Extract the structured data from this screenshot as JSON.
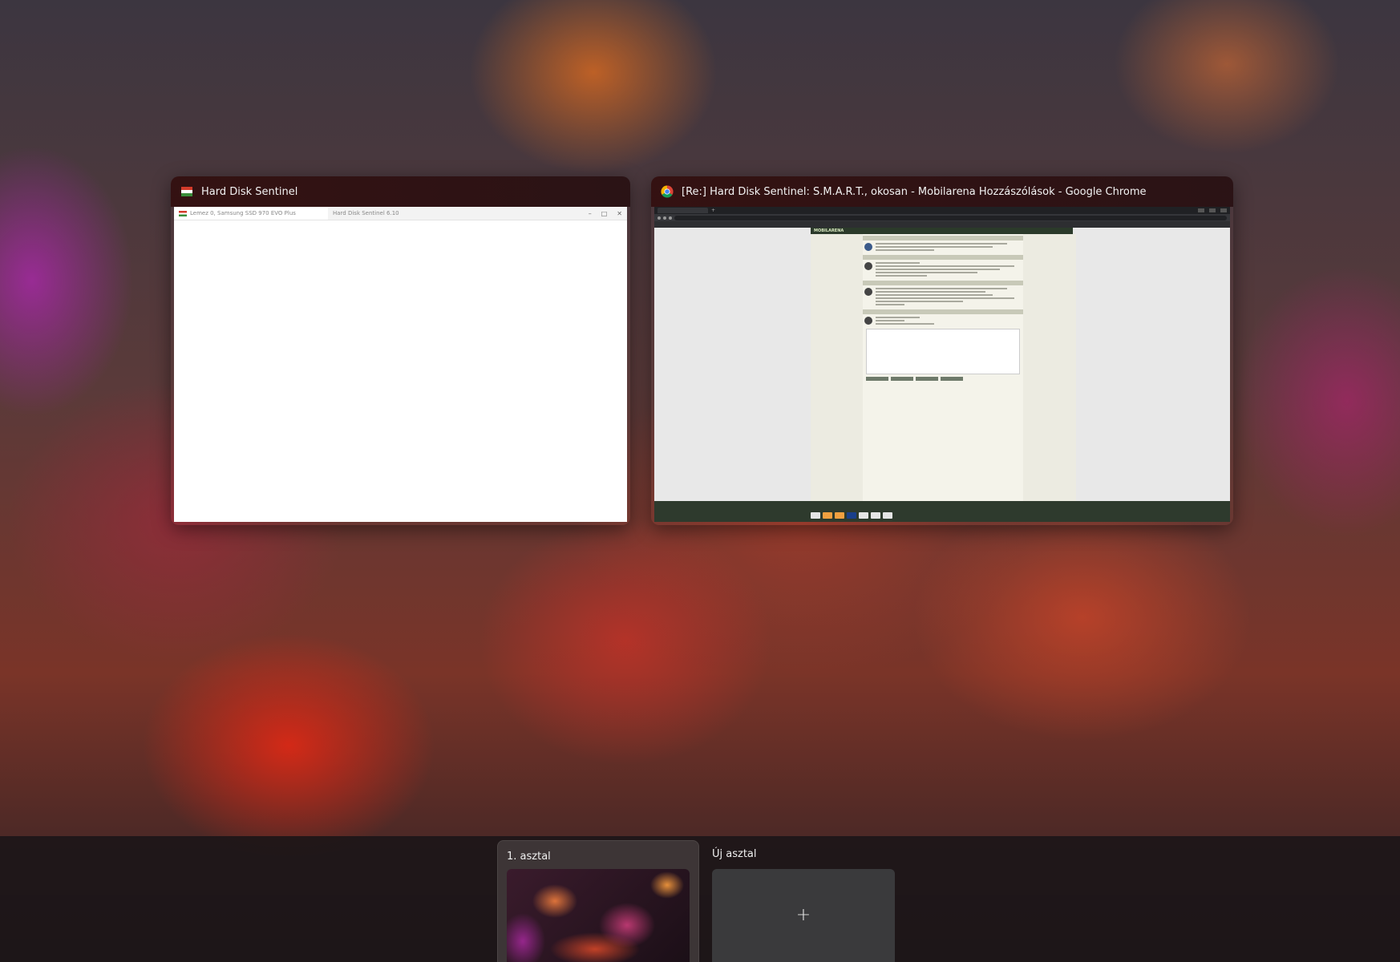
{
  "windows": [
    {
      "title": "Hard Disk Sentinel",
      "thumbnail": {
        "tab_label": "Lemez 0, Samsung SSD 970 EVO Plus",
        "window_title": "Hard Disk Sentinel 6.10"
      }
    },
    {
      "title": "[Re:] Hard Disk Sentinel: S.M.A.R.T., okosan - Mobilarena Hozzászólások - Google Chrome",
      "thumbnail": {
        "site_logo": "MOBILARENA"
      }
    }
  ],
  "desktops": [
    {
      "label": "1. asztal"
    },
    {
      "label": "Új asztal"
    }
  ],
  "icons": {
    "hds_app": "hard-disk-sentinel-icon",
    "chrome_app": "chrome-icon",
    "add_desktop": "plus-icon"
  },
  "colors": {
    "titlebar": "#32100f",
    "desk_bar": "#1c1618",
    "new_desk_tile": "#3a3a3c"
  }
}
